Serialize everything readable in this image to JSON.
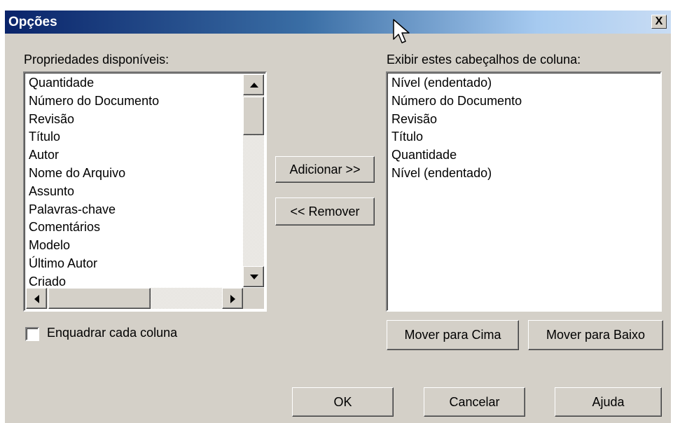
{
  "window": {
    "title": "Opções",
    "close_label": "X"
  },
  "available": {
    "label": "Propriedades disponíveis:",
    "items": [
      "Quantidade",
      "Número do Documento",
      "Revisão",
      "Título",
      "Autor",
      "Nome do Arquivo",
      "Assunto",
      "Palavras-chave",
      "Comentários",
      "Modelo",
      "Último Autor",
      "Criado"
    ]
  },
  "displayed": {
    "label": "Exibir estes cabeçalhos de coluna:",
    "items": [
      "Nível (endentado)",
      "Número do Documento",
      "Revisão",
      "Título",
      "Quantidade",
      "Nível (endentado)"
    ]
  },
  "buttons": {
    "add": "Adicionar >>",
    "remove": "<< Remover",
    "move_up": "Mover para Cima",
    "move_down": "Mover para Baixo",
    "ok": "OK",
    "cancel": "Cancelar",
    "help": "Ajuda"
  },
  "wrap_checkbox": {
    "label": "Enquadrar cada coluna",
    "checked": false
  },
  "icons": {
    "close": "close-icon",
    "scroll_up": "arrow-up-icon",
    "scroll_down": "arrow-down-icon",
    "scroll_left": "arrow-left-icon",
    "scroll_right": "arrow-right-icon",
    "cursor": "mouse-pointer-icon"
  },
  "colors": {
    "titlebar_start": "#0a246a",
    "titlebar_end": "#c8dcf4",
    "face": "#d4d0c8"
  }
}
